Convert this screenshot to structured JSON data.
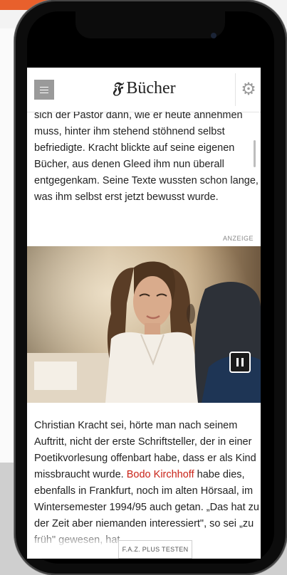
{
  "header": {
    "logo_letter": "𝔉",
    "title": "Bücher"
  },
  "article": {
    "paragraph1": "sich der Pastor dann, wie er heute annehmen muss, hinter ihm stehend stöhnend selbst befriedigte. Kracht blickte auf seine eigenen Bücher, aus denen Gleed ihm nun überall entgegenkam. Seine Texte wussten schon lange, was ihm selbst erst jetzt bewusst wurde.",
    "ad_label": "ANZEIGE",
    "paragraph2_before": "Christian Kracht sei, hörte man nach seinem Auftritt, nicht der erste Schriftsteller, der in einer Poetikvorlesung offenbart habe, dass er als Kind missbraucht wurde.",
    "paragraph2_link": "Bodo Kirchhoff",
    "paragraph2_after": "habe dies, ebenfalls in Frankfurt, noch im alten Hörsaal, im Wintersemester 1994/95 auch getan. „Das hat zu der Zeit aber niemanden interessiert\", so sei „zu früh\" gewesen, hat"
  },
  "footer": {
    "plus_button": "F.A.Z. PLUS TESTEN"
  },
  "icons": {
    "menu": "menu-icon",
    "settings": "gear-icon",
    "pause": "pause-icon"
  },
  "colors": {
    "link": "#c92318",
    "menu_button": "#9a9a9a"
  }
}
